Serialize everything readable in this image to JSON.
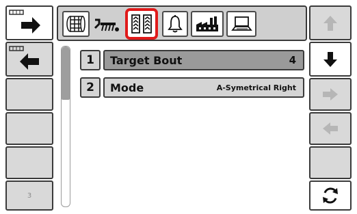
{
  "left_panel": {
    "page_number": "3"
  },
  "list": {
    "items": [
      {
        "number": "1",
        "label": "Target Bout",
        "value": "4"
      },
      {
        "number": "2",
        "label": "Mode",
        "value": "A-Symetrical Right"
      }
    ]
  },
  "tabs": [
    {
      "name": "wheel-tab",
      "icon": "grain-cart-wheel-icon"
    },
    {
      "name": "implement-tab",
      "icon": "tillage-implement-icon"
    },
    {
      "name": "tracks-tab",
      "icon": "guidance-tracks-icon",
      "active": true
    },
    {
      "name": "alarm-tab",
      "icon": "bell-icon"
    },
    {
      "name": "factory-tab",
      "icon": "factory-icon"
    },
    {
      "name": "laptop-tab",
      "icon": "laptop-icon"
    }
  ],
  "colors": {
    "active_tab_border": "#e01a1a",
    "button_gray": "#d9d9d9",
    "selected_row": "#9a9a9a"
  }
}
